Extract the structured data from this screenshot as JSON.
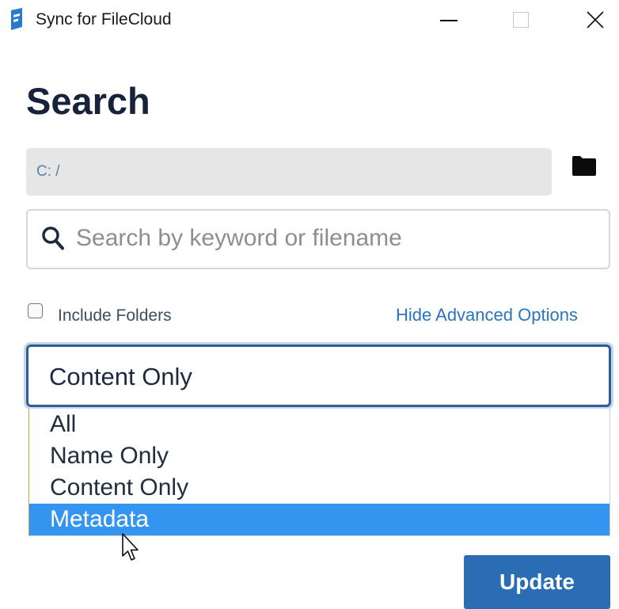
{
  "window": {
    "title": "Sync for FileCloud",
    "icon": "filecloud-logo-icon",
    "controls": [
      "minimize-icon",
      "maximize-icon",
      "close-icon"
    ]
  },
  "page": {
    "title": "Search"
  },
  "path": {
    "value": "C: /",
    "icon": "folder-icon"
  },
  "search": {
    "placeholder": "Search by keyword or filename",
    "icon": "search-icon"
  },
  "options": {
    "include_folders_label": "Include Folders",
    "include_folders_checked": false,
    "advanced_link": "Hide Advanced Options"
  },
  "search_type": {
    "selected": "Content Only",
    "options": [
      "All",
      "Name Only",
      "Content Only",
      "Metadata"
    ],
    "highlighted": "Metadata"
  },
  "actions": {
    "update_label": "Update"
  },
  "colors": {
    "title": "#16233a",
    "link": "#2b74c2",
    "highlight": "#3395f0",
    "button": "#2a6db5",
    "path_bg": "#e6e6e6"
  }
}
